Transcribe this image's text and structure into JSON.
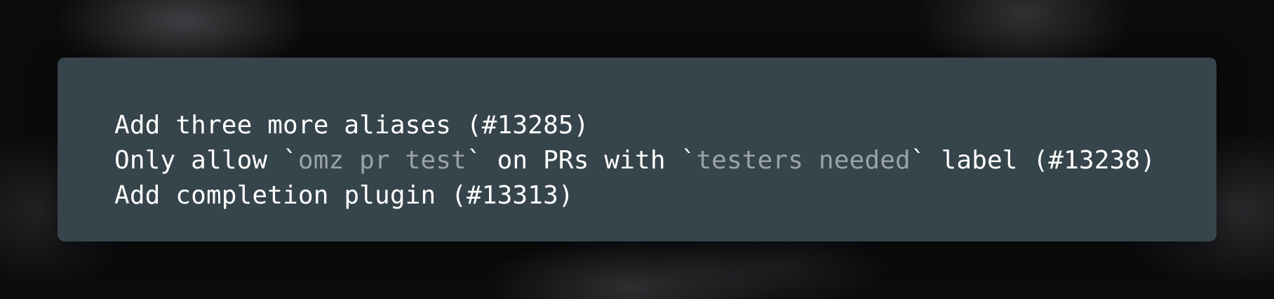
{
  "log": {
    "lines": [
      {
        "text": "Add three more aliases (#13285)"
      },
      {
        "prefix": "Only allow `",
        "code1": "omz pr test",
        "middle": "` on PRs with `",
        "code2": "testers needed",
        "suffix": "` label (#13238)"
      },
      {
        "text": "Add completion plugin (#13313)"
      }
    ]
  }
}
